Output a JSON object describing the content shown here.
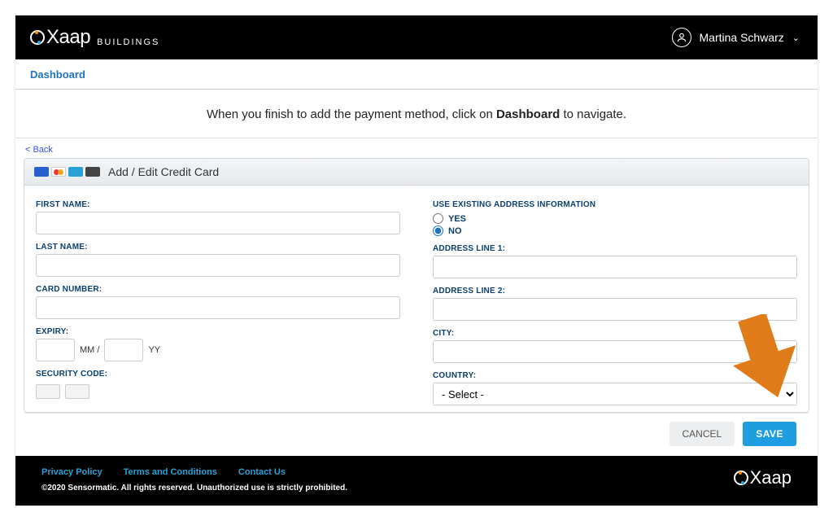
{
  "header": {
    "brand": "Xaap",
    "brand_sub": "BUILDINGS",
    "user_name": "Martina Schwarz"
  },
  "breadcrumb": {
    "dashboard": "Dashboard"
  },
  "instruction": {
    "prefix": "When you finish to add the payment method, click on ",
    "bold": "Dashboard",
    "suffix": " to navigate."
  },
  "form": {
    "back": "< Back",
    "panel_title": "Add / Edit Credit Card",
    "labels": {
      "first_name": "FIRST NAME:",
      "last_name": "LAST NAME:",
      "card_number": "CARD NUMBER:",
      "expiry": "EXPIRY:",
      "mm_sep": "MM /",
      "yy": "YY",
      "security_code": "SECURITY CODE:",
      "use_existing": "USE EXISTING ADDRESS INFORMATION",
      "yes": "YES",
      "no": "NO",
      "addr1": "ADDRESS LINE 1:",
      "addr2": "ADDRESS LINE 2:",
      "city": "CITY:",
      "country": "COUNTRY:"
    },
    "values": {
      "first_name": "",
      "last_name": "",
      "card_number": "",
      "exp_mm": "",
      "exp_yy": "",
      "security_code": "",
      "use_existing": "no",
      "addr1": "",
      "addr2": "",
      "city": "",
      "country_selected": "- Select -"
    },
    "buttons": {
      "cancel": "CANCEL",
      "save": "SAVE"
    }
  },
  "footer": {
    "links": {
      "privacy": "Privacy Policy",
      "terms": "Terms and Conditions",
      "contact": "Contact Us"
    },
    "copyright": "©2020 Sensormatic. All rights reserved. Unauthorized use is strictly prohibited.",
    "brand": "Xaap"
  }
}
